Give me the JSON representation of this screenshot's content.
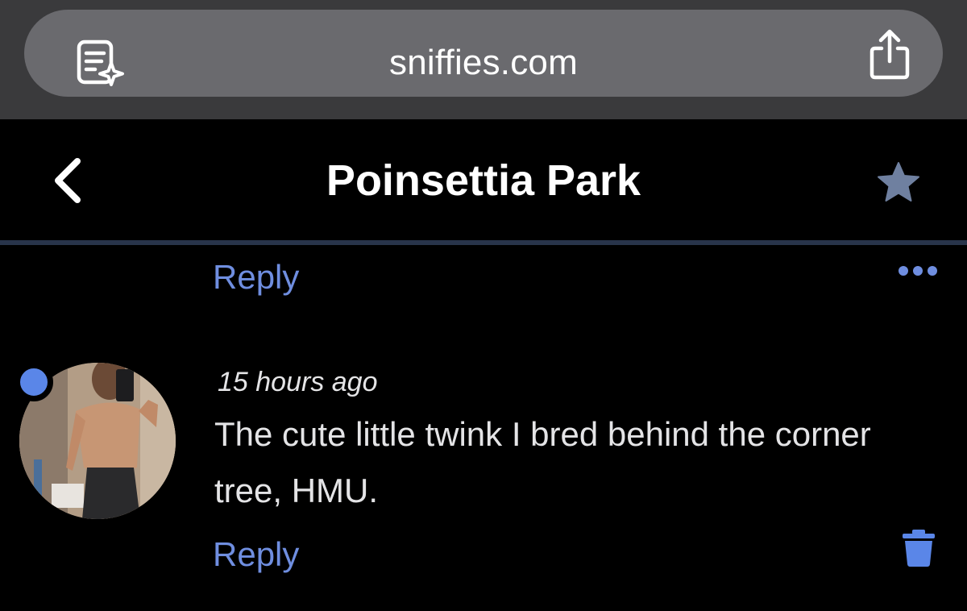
{
  "browser": {
    "url": "sniffies.com",
    "reader_icon": "reader-mode-sparkle-icon",
    "share_icon": "share-icon"
  },
  "header": {
    "title": "Poinsettia Park",
    "back_icon": "chevron-left-icon",
    "favorite_icon": "star-icon"
  },
  "feed": {
    "prev_reply_label": "Reply",
    "more_icon": "ellipsis-icon",
    "comments": [
      {
        "timestamp": "15 hours ago",
        "text": "The cute little twink I bred behind the corner tree, HMU.",
        "reply_label": "Reply",
        "delete_icon": "trash-icon",
        "online": true
      }
    ]
  },
  "colors": {
    "chrome_bg": "#3a3a3c",
    "address_pill": "#6a6a6e",
    "accent": "#6f8ee0",
    "status_dot": "#5a86e8",
    "icon_gray_blue": "#6f80a0",
    "divider": "#28344a",
    "background": "#000000",
    "text": "#e4e4e6"
  }
}
